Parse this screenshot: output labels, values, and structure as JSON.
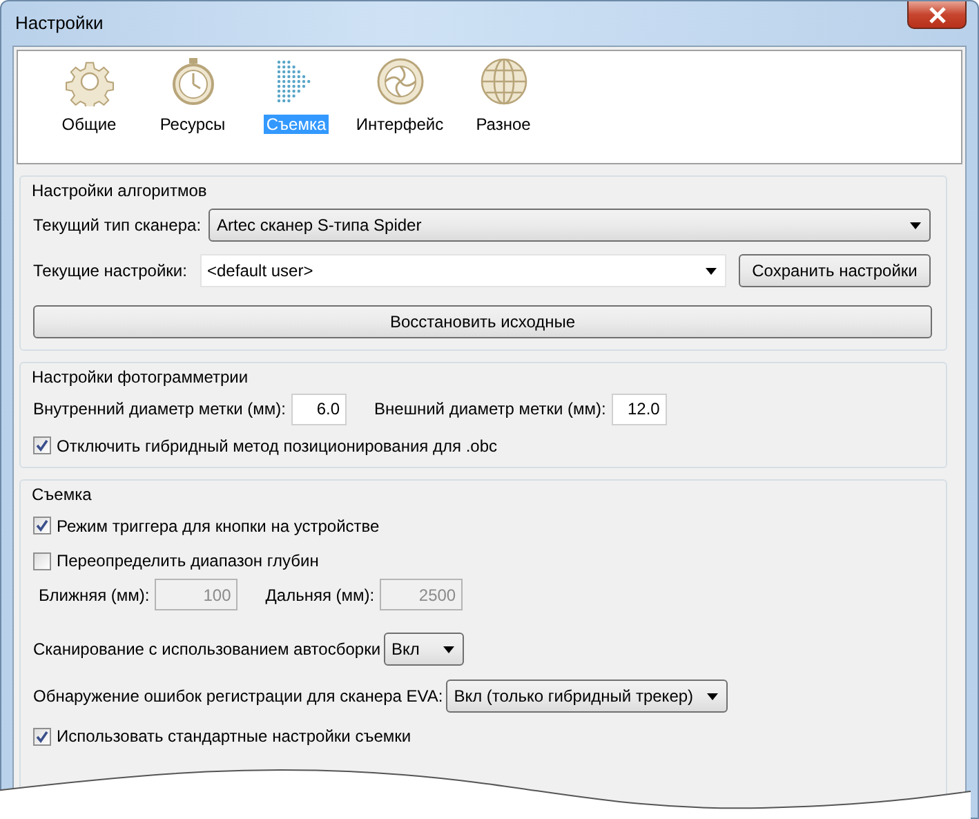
{
  "window": {
    "title": "Настройки"
  },
  "tabs": [
    {
      "label": "Общие",
      "selected": false
    },
    {
      "label": "Ресурсы",
      "selected": false
    },
    {
      "label": "Съемка",
      "selected": true
    },
    {
      "label": "Интерфейс",
      "selected": false
    },
    {
      "label": "Разное",
      "selected": false
    }
  ],
  "algorithm_settings": {
    "title": "Настройки алгоритмов",
    "scanner_type": {
      "label": "Текущий тип сканера:",
      "value": "Artec сканер S-типа Spider"
    },
    "current_settings": {
      "label": "Текущие настройки:",
      "value": "<default user>"
    },
    "save_button": "Сохранить настройки",
    "reset_button": "Восстановить исходные"
  },
  "photogrammetry_settings": {
    "title": "Настройки фотограмметрии",
    "inner_diameter": {
      "label": "Внутренний диаметр метки (мм):",
      "value": "6.0"
    },
    "outer_diameter": {
      "label": "Внешний диаметр метки (мм):",
      "value": "12.0"
    },
    "disable_hybrid": {
      "label": "Отключить гибридный метод позиционирования для .obc",
      "checked": true
    }
  },
  "capture": {
    "title": "Съемка",
    "trigger_mode": {
      "label": "Режим триггера для кнопки на устройстве",
      "checked": true
    },
    "override_depth": {
      "label": "Переопределить диапазон глубин",
      "checked": false
    },
    "near": {
      "label": "Ближняя (мм):",
      "value": "100",
      "disabled": true
    },
    "far": {
      "label": "Дальняя (мм):",
      "value": "2500",
      "disabled": true
    },
    "autoassembly": {
      "label": "Сканирование с использованием автосборки",
      "value": "Вкл"
    },
    "eva_errors": {
      "label": "Обнаружение ошибок регистрации для сканера EVA:",
      "value": "Вкл (только гибридный трекер)"
    },
    "use_defaults": {
      "label": "Использовать стандартные настройки съемки",
      "checked": true
    }
  }
}
